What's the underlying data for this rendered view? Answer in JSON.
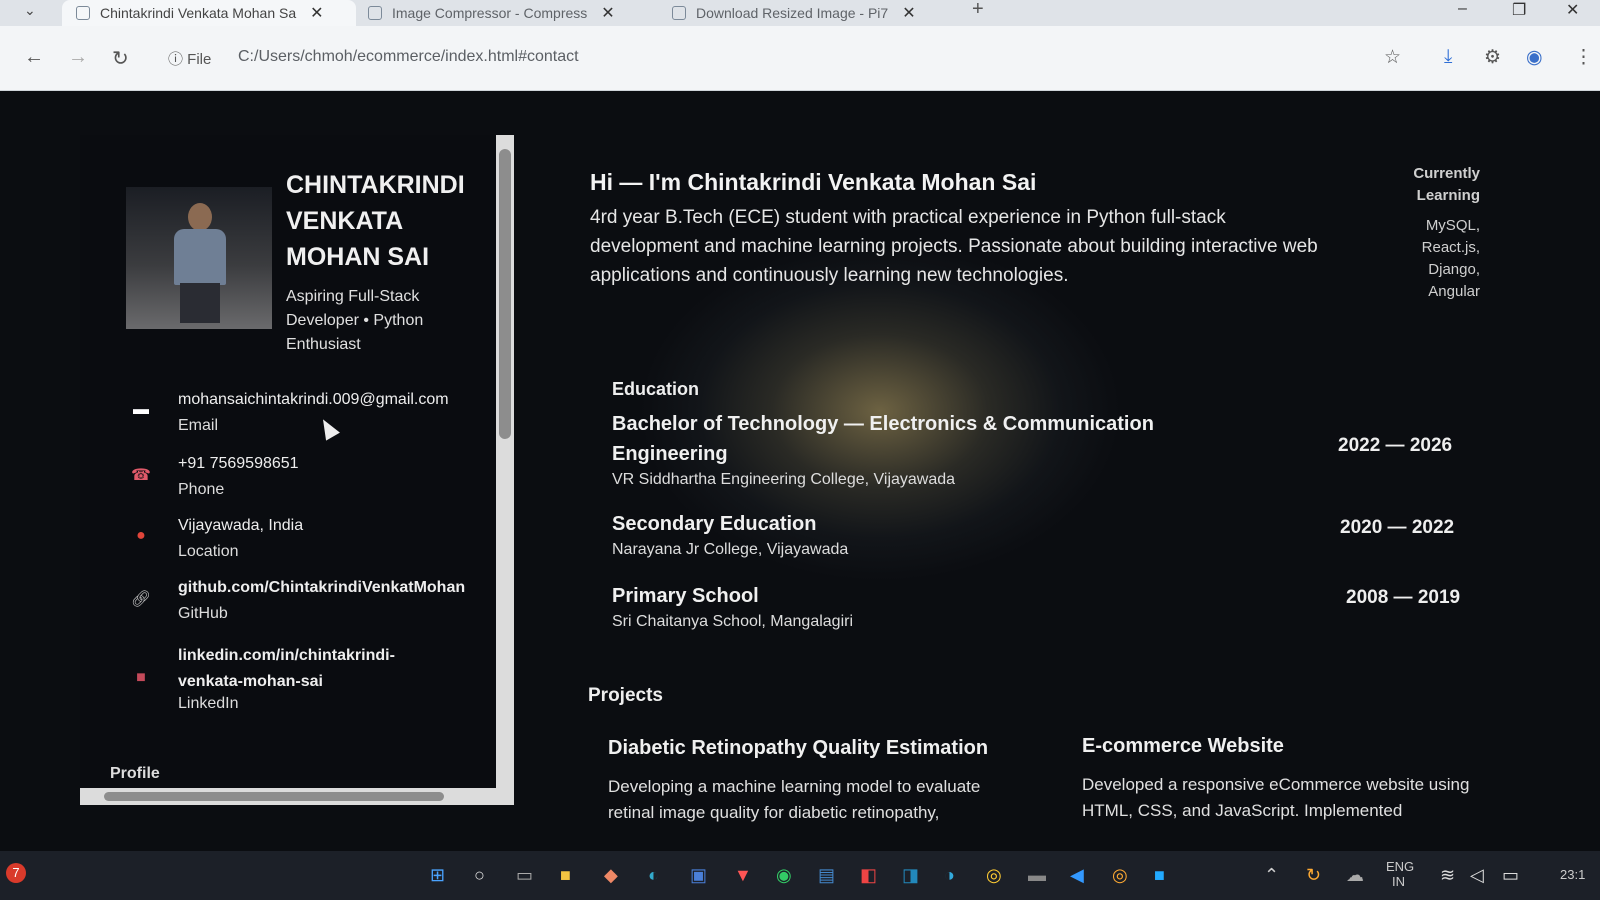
{
  "browser": {
    "tabs": [
      {
        "title": "Chintakrindi Venkata Mohan Sa",
        "active": true
      },
      {
        "title": "Image Compressor - Compress",
        "active": false
      },
      {
        "title": "Download Resized Image - Pi7",
        "active": false
      }
    ],
    "new_tab": "+",
    "file_label": "File",
    "url": "C:/Users/chmoh/ecommerce/index.html#contact",
    "window_controls": [
      "–",
      "❐",
      "✕"
    ]
  },
  "sidebar": {
    "name": "CHINTAKRINDI VENKATA MOHAN SAI",
    "tagline": "Aspiring Full-Stack Developer • Python Enthusiast",
    "contacts": [
      {
        "icon": "email-icon",
        "value": "mohansaichintakrindi.009@gmail.com",
        "label": "Email"
      },
      {
        "icon": "phone-icon",
        "value": "+91 7569598651",
        "label": "Phone"
      },
      {
        "icon": "location-pin-icon",
        "value": "Vijayawada, India",
        "label": "Location"
      },
      {
        "icon": "link-icon",
        "value": "github.com/ChintakrindiVenkatMohan",
        "label": "GitHub"
      },
      {
        "icon": "briefcase-icon",
        "value": "linkedin.com/in/chintakrindi-venkata-mohan-sai",
        "label": "LinkedIn"
      }
    ],
    "profile_heading": "Profile"
  },
  "main": {
    "hero_title": "Hi — I'm Chintakrindi Venkata Mohan Sai",
    "intro": "4rd year B.Tech (ECE) student with practical experience in Python full-stack development and machine learning projects. Passionate about building interactive web applications and continuously learning new technologies.",
    "currently_learning": {
      "title": "Currently Learning",
      "items": "MySQL, React.js, Django, Angular"
    },
    "education_heading": "Education",
    "education": [
      {
        "degree": "Bachelor of Technology — Electronics & Communication Engineering",
        "institution": "VR Siddhartha Engineering College, Vijayawada",
        "years": "2022 — 2026"
      },
      {
        "degree": "Secondary Education",
        "institution": "Narayana Jr College, Vijayawada",
        "years": "2020 — 2022"
      },
      {
        "degree": "Primary School",
        "institution": "Sri Chaitanya School, Mangalagiri",
        "years": "2008 — 2019"
      }
    ],
    "projects_heading": "Projects",
    "projects": [
      {
        "title": "Diabetic Retinopathy Quality Estimation",
        "desc": "Developing a machine learning model to evaluate retinal image quality for diabetic retinopathy,"
      },
      {
        "title": "E-commerce Website",
        "desc": "Developed a responsive eCommerce website using HTML, CSS, and JavaScript. Implemented"
      }
    ]
  },
  "taskbar": {
    "notification_count": "7",
    "language": "ENG",
    "region": "IN",
    "time_partial": "23:1"
  }
}
